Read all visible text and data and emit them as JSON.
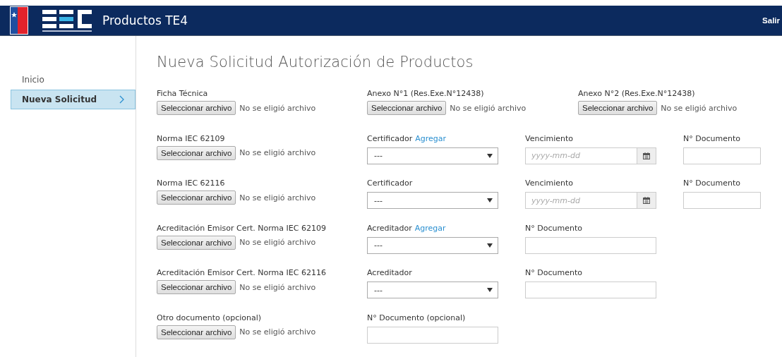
{
  "header": {
    "title": "Productos TE4",
    "logout": "Salir"
  },
  "sidebar": {
    "items": [
      {
        "label": "Inicio",
        "selected": false
      },
      {
        "label": "Nueva Solicitud",
        "selected": true
      }
    ]
  },
  "page_title": "Nueva Solicitud Autorización de Productos",
  "rows": [
    {
      "kind": "thirds",
      "fields": [
        {
          "kind": "file",
          "label": "Ficha Técnica",
          "button": "Seleccionar archivo",
          "status": "No se eligió archivo"
        },
        {
          "kind": "file",
          "label": "Anexo N°1 (Res.Exe.N°12438)",
          "button": "Seleccionar archivo",
          "status": "No se eligió archivo"
        },
        {
          "kind": "file",
          "label": "Anexo N°2 (Res.Exe.N°12438)",
          "button": "Seleccionar archivo",
          "status": "No se eligió archivo"
        }
      ]
    },
    {
      "kind": "quarters",
      "fields": [
        {
          "kind": "file",
          "label": "Norma IEC 62109",
          "button": "Seleccionar archivo",
          "status": "No se eligió archivo"
        },
        {
          "kind": "select",
          "label": "Certificador",
          "link": "Agregar",
          "value": "---"
        },
        {
          "kind": "date",
          "label": "Vencimiento",
          "placeholder": "yyyy-mm-dd"
        },
        {
          "kind": "text",
          "label": "N° Documento"
        }
      ]
    },
    {
      "kind": "quarters",
      "fields": [
        {
          "kind": "file",
          "label": "Norma IEC 62116",
          "button": "Seleccionar archivo",
          "status": "No se eligió archivo"
        },
        {
          "kind": "select",
          "label": "Certificador",
          "value": "---"
        },
        {
          "kind": "date",
          "label": "Vencimiento",
          "placeholder": "yyyy-mm-dd"
        },
        {
          "kind": "text",
          "label": "N° Documento"
        }
      ]
    },
    {
      "kind": "quarters",
      "fields": [
        {
          "kind": "file",
          "label": "Acreditación Emisor Cert. Norma IEC 62109",
          "button": "Seleccionar archivo",
          "status": "No se eligió archivo"
        },
        {
          "kind": "select",
          "label": "Acreditador",
          "link": "Agregar",
          "value": "---"
        },
        {
          "kind": "wide-text",
          "label": "N° Documento"
        }
      ]
    },
    {
      "kind": "quarters",
      "fields": [
        {
          "kind": "file",
          "label": "Acreditación Emisor Cert. Norma IEC 62116",
          "button": "Seleccionar archivo",
          "status": "No se eligió archivo"
        },
        {
          "kind": "select",
          "label": "Acreditador",
          "value": "---"
        },
        {
          "kind": "wide-text",
          "label": "N° Documento"
        }
      ]
    },
    {
      "kind": "quarters",
      "fields": [
        {
          "kind": "file",
          "label": "Otro documento (opcional)",
          "button": "Seleccionar archivo",
          "status": "No se eligió archivo"
        },
        {
          "kind": "wide-text",
          "label": "N° Documento (opcional)"
        }
      ]
    }
  ]
}
